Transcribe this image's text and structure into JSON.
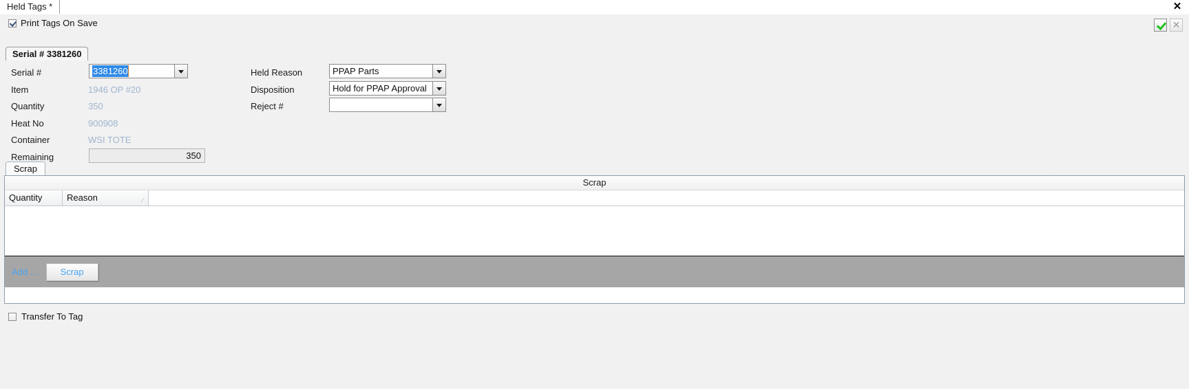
{
  "window": {
    "document_tab": "Held Tags *",
    "close_icon": "close-icon",
    "close_glyph": "✕"
  },
  "optionbar": {
    "print_tags_label": "Print Tags On Save",
    "print_tags_checked": true,
    "accept_icon": "check-icon",
    "cancel_icon": "x-icon",
    "accept_color": "#20c020",
    "cancel_color": "#9a9a9a"
  },
  "serial_group": {
    "tab_label": "Serial # 3381260"
  },
  "form": {
    "left": {
      "serial_label": "Serial #",
      "serial_value": "3381260",
      "item_label": "Item",
      "item_value": "1946 OP #20",
      "quantity_label": "Quantity",
      "quantity_value": "350",
      "heat_label": "Heat No",
      "heat_value": "900908",
      "container_label": "Container",
      "container_value": "WSI TOTE",
      "remaining_label": "Remaining",
      "remaining_value": "350"
    },
    "right": {
      "held_reason_label": "Held Reason",
      "held_reason_value": "PPAP Parts",
      "disposition_label": "Disposition",
      "disposition_value": "Hold for PPAP Approval",
      "reject_label": "Reject #",
      "reject_value": ""
    },
    "readonly_text_color": "#9fb4d0",
    "selection_color": "#2f8ae8"
  },
  "scrap_section": {
    "tab_label": "Scrap",
    "grid_caption": "Scrap",
    "columns": [
      {
        "label": "Quantity",
        "width": 84
      },
      {
        "label": "Reason",
        "width": 125,
        "sort_indicator": "⁄"
      }
    ],
    "rows": [],
    "footer": {
      "add_label": "Add ...",
      "scrap_button_label": "Scrap",
      "link_color": "#4aa3ef",
      "bar_color": "#a6a6a6"
    }
  },
  "bottom": {
    "transfer_label": "Transfer To Tag",
    "transfer_checked": false
  }
}
